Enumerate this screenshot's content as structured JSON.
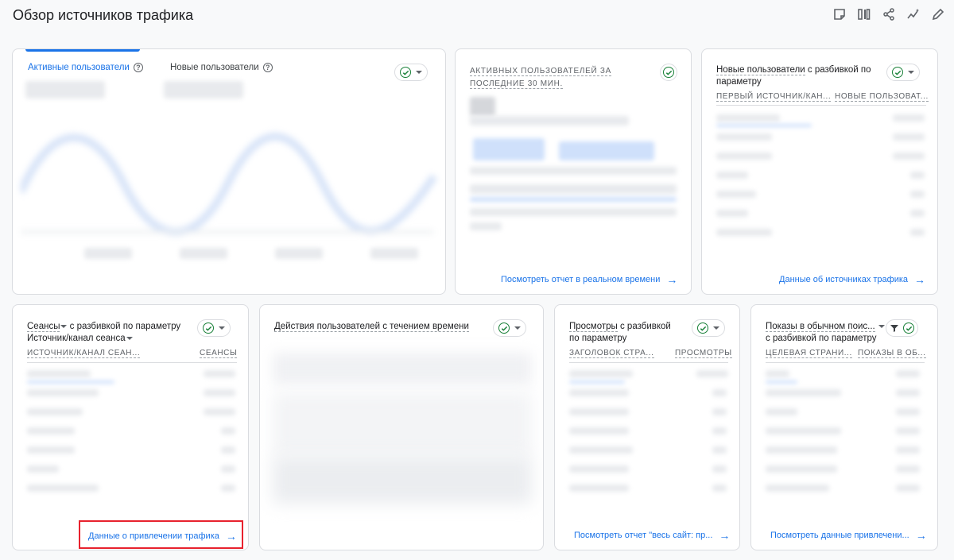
{
  "header": {
    "title": "Обзор источников трафика",
    "tools": [
      "customize-report-icon",
      "compare-icon",
      "share-icon",
      "insights-icon",
      "edit-icon"
    ]
  },
  "card_users": {
    "tab_active": "Активные пользователи",
    "tab_new": "Новые пользователи"
  },
  "card_realtime": {
    "title": "АКТИВНЫХ ПОЛЬЗОВАТЕЛЕЙ ЗА ПОСЛЕДНИЕ 30 МИН.",
    "link": "Посмотреть отчет в реальном времени"
  },
  "card_new_users": {
    "title_main": "Новые пользователи",
    "title_rest": " с разбивкой по параметру",
    "col1": "ПЕРВЫЙ ИСТОЧНИК/КАН...",
    "col2": "НОВЫЕ ПОЛЬЗОВАТ...",
    "link": "Данные об источниках трафика"
  },
  "card_sessions": {
    "title_main": "Сеансы",
    "title_rest": " с разбивкой по параметру",
    "subtitle": "Источник/канал сеанса",
    "col1": "ИСТОЧНИК/КАНАЛ СЕАН...",
    "col2": "СЕАНСЫ",
    "link": "Данные о привлечении трафика"
  },
  "card_actions": {
    "title": "Действия пользователей с течением времени"
  },
  "card_views": {
    "title_main": "Просмотры",
    "title_rest": " с разбивкой по параметру",
    "col1": "ЗАГОЛОВОК СТРА...",
    "col2": "ПРОСМОТРЫ",
    "link": "Посмотреть отчет \"весь сайт: пр..."
  },
  "card_search": {
    "title_main": "Показы в обычном поис...",
    "title_rest": "с разбивкой по параметру",
    "col1": "ЦЕЛЕВАЯ СТРАНИ...",
    "col2": "ПОКАЗЫ В ОБ...",
    "link": "Посмотреть данные привлечени..."
  },
  "colors": {
    "link": "#1a73e8",
    "check": "#188038",
    "highlight": "#e8222e"
  }
}
